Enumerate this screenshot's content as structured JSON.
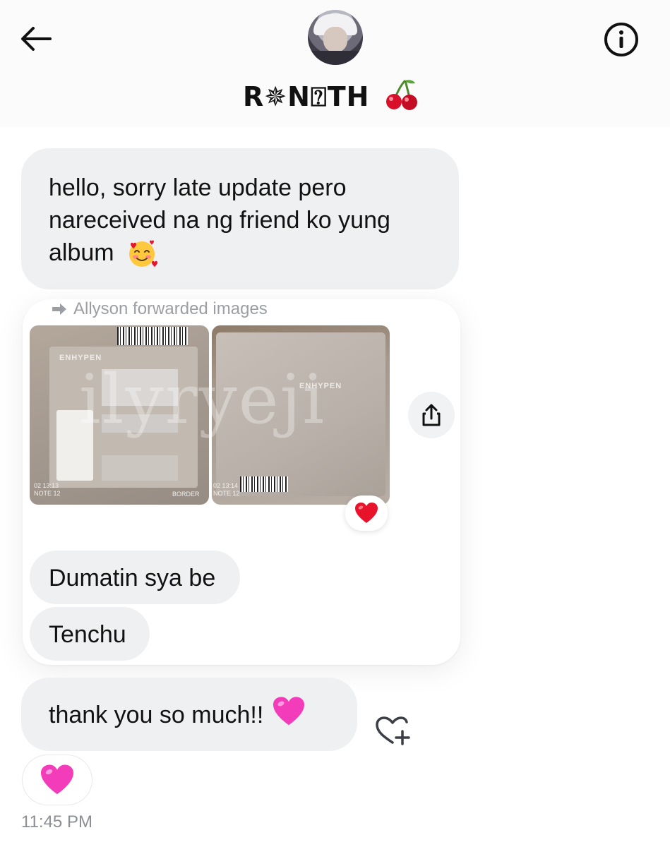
{
  "header": {
    "contact_name": "R✵N⍰TH",
    "contact_emoji": "cherries-emoji",
    "back_icon": "arrow-left-icon",
    "info_icon": "info-icon"
  },
  "messages": {
    "m1_text": "hello, sorry late update pero nareceived na ng friend ko yung album",
    "m1_emoji": "smiling-face-with-hearts-emoji",
    "forward_label": "Allyson forwarded images",
    "forward_icon": "forward-arrow-icon",
    "photo_watermark": "ilyryeji",
    "photo_brand": "ENHYPEN",
    "photo1_stamp_line1": "02 13:13",
    "photo1_stamp_line2": "NOTE 12",
    "photo2_stamp_line1": "02 13:14",
    "photo2_stamp_line2": "NOTE 12",
    "photo1_footer_word": "BORDER",
    "photo_reaction": "red-heart-emoji",
    "m2_text": "Dumatin sya be",
    "m3_text": "Tenchu",
    "m4_text": "thank you so much!!",
    "m4_emoji": "pink-heart-emoji",
    "m4_reaction": "pink-heart-emoji",
    "timestamp": "11:45 PM"
  },
  "colors": {
    "bubble": "#eef0f1",
    "muted_text": "#9b9ea3",
    "red_heart": "#e8132b",
    "pink_heart": "#f23cba"
  }
}
